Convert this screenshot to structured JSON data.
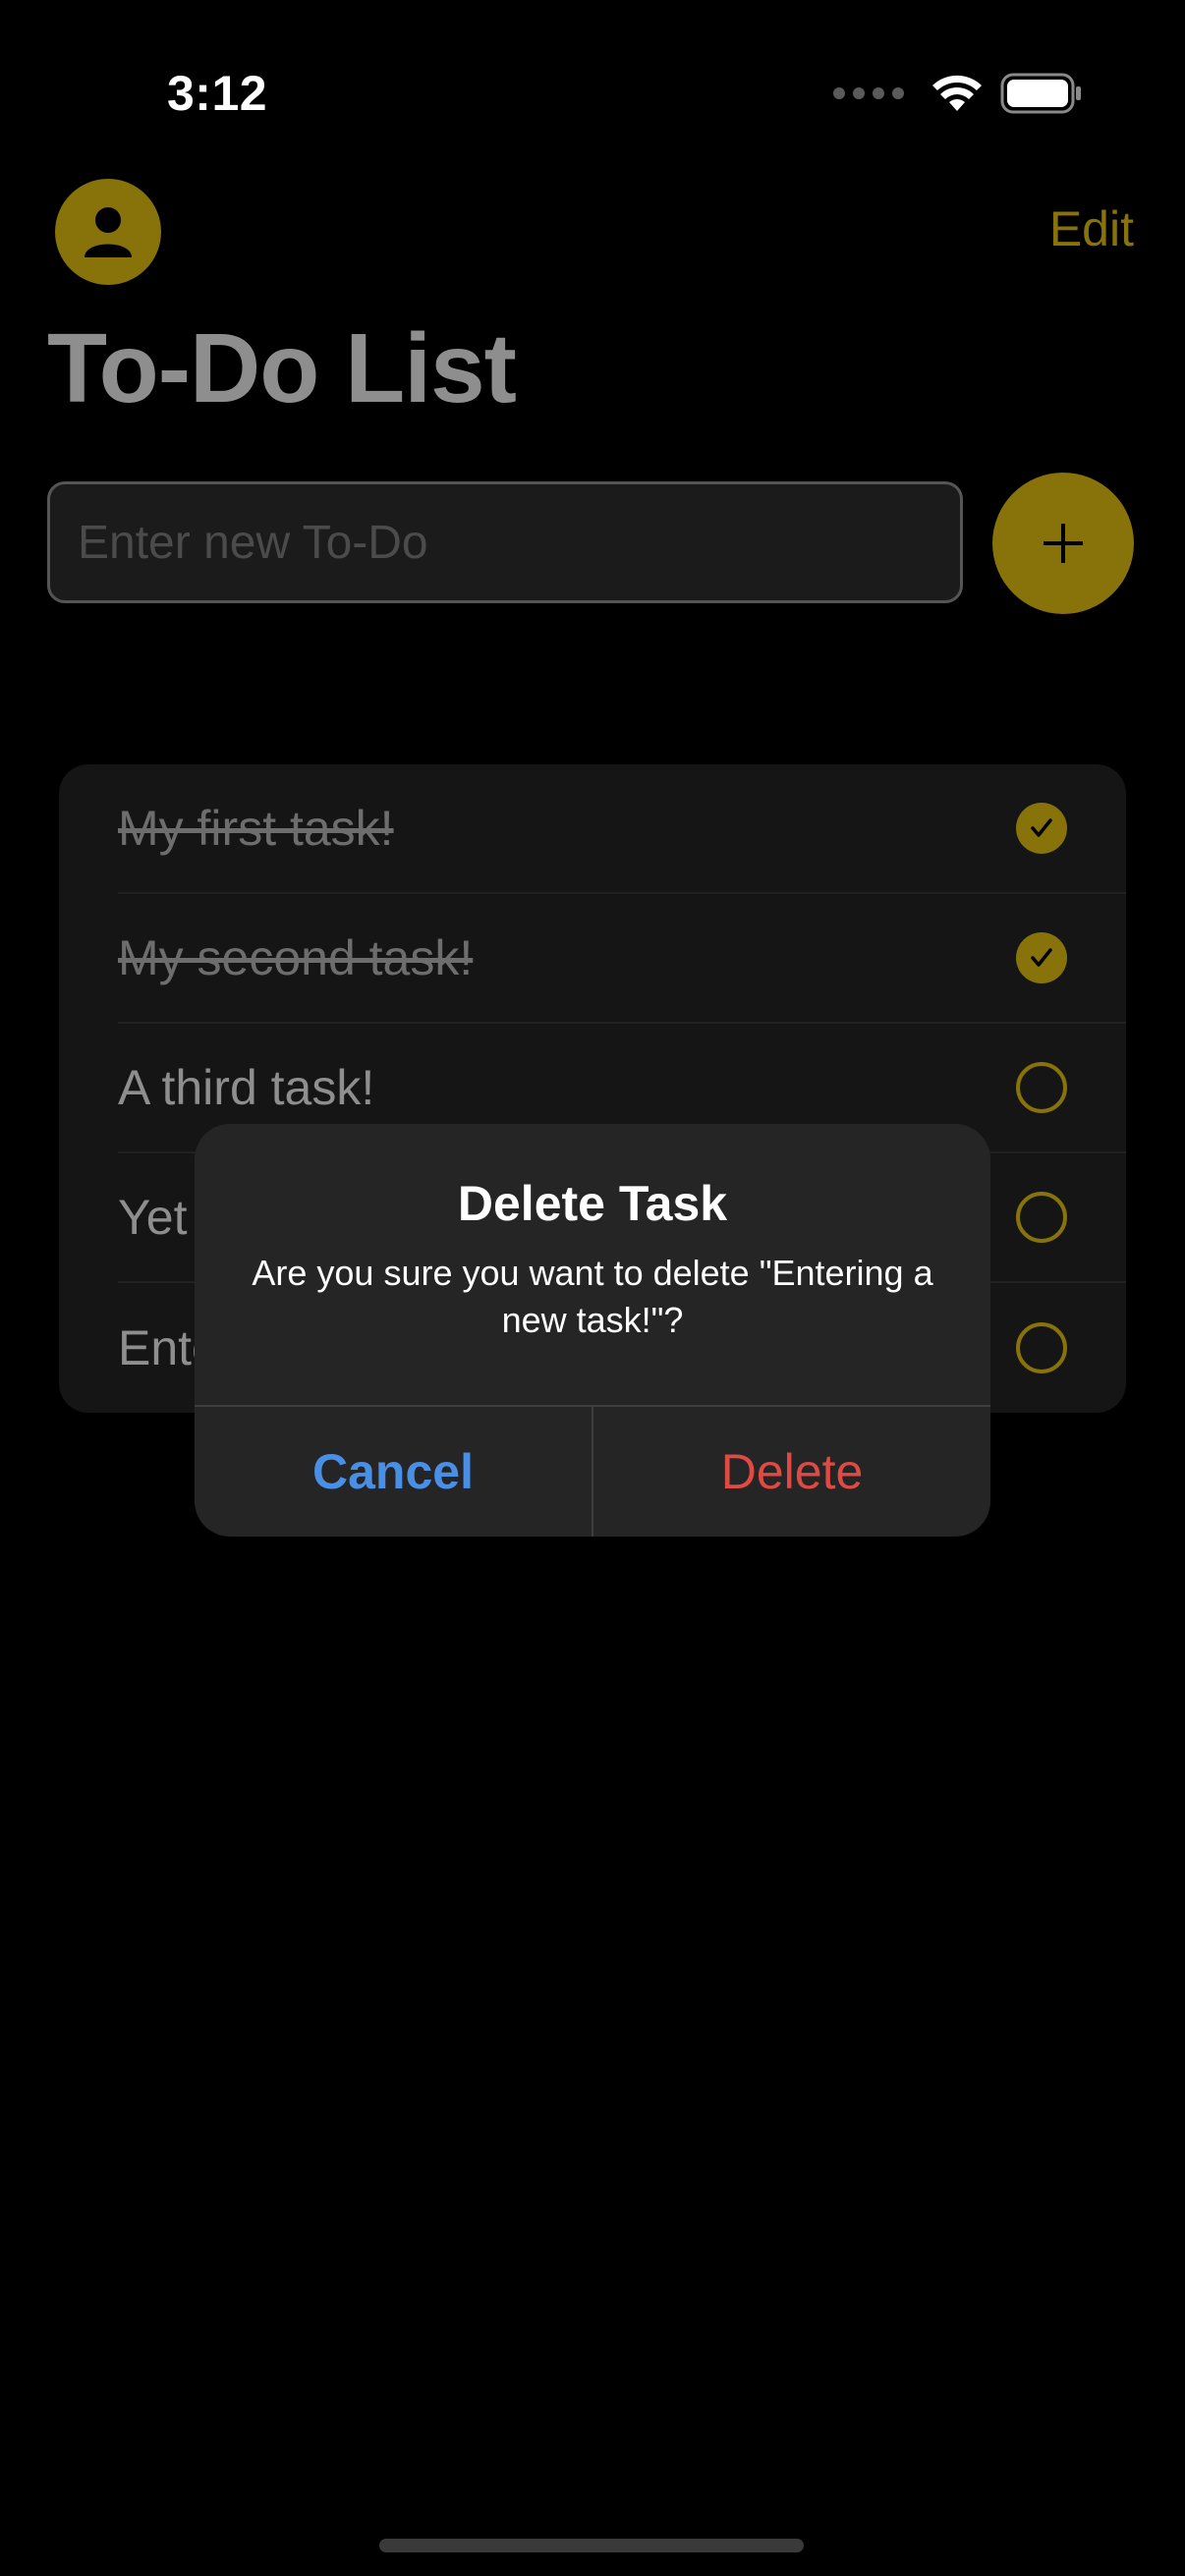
{
  "status_bar": {
    "time": "3:12"
  },
  "header": {
    "avatar_icon": "person-icon",
    "edit_label": "Edit",
    "title": "To-Do List"
  },
  "input": {
    "placeholder": "Enter new To-Do",
    "add_icon": "plus-icon"
  },
  "tasks": [
    {
      "text": "My first task!",
      "done": true
    },
    {
      "text": "My second task!",
      "done": true
    },
    {
      "text": "A third task!",
      "done": false
    },
    {
      "text": "Yet",
      "done": false
    },
    {
      "text": "Ente",
      "done": false
    }
  ],
  "alert": {
    "title": "Delete Task",
    "message": "Are you sure you want to delete \"Entering a new task!\"?",
    "cancel_label": "Cancel",
    "delete_label": "Delete"
  },
  "colors": {
    "accent": "#87730a",
    "background": "#000000",
    "cancel": "#4a8fe6",
    "destructive": "#e04a45"
  }
}
